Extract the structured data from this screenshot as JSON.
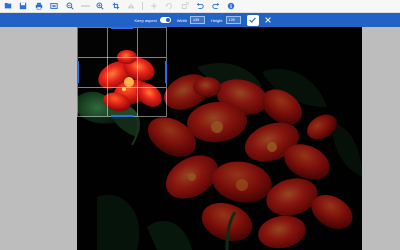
{
  "toolbar": {
    "icons": [
      "open-icon",
      "save-icon",
      "print-icon",
      "fit-icon",
      "zoom-out-icon",
      "zoom-level",
      "zoom-in-icon",
      "crop-icon",
      "flip-icon",
      "add-icon",
      "rotate-icon",
      "transform-icon",
      "undo-icon",
      "redo-icon",
      "info-icon"
    ]
  },
  "cropbar": {
    "keep_aspect_label": "Keep aspect",
    "keep_aspect_on": true,
    "width_label": "Width",
    "width_value": "139",
    "height_label": "Height",
    "height_value": "139"
  },
  "colors": {
    "accent": "#2262c6",
    "background": "#bdbdbd",
    "canvas": "#020202"
  }
}
